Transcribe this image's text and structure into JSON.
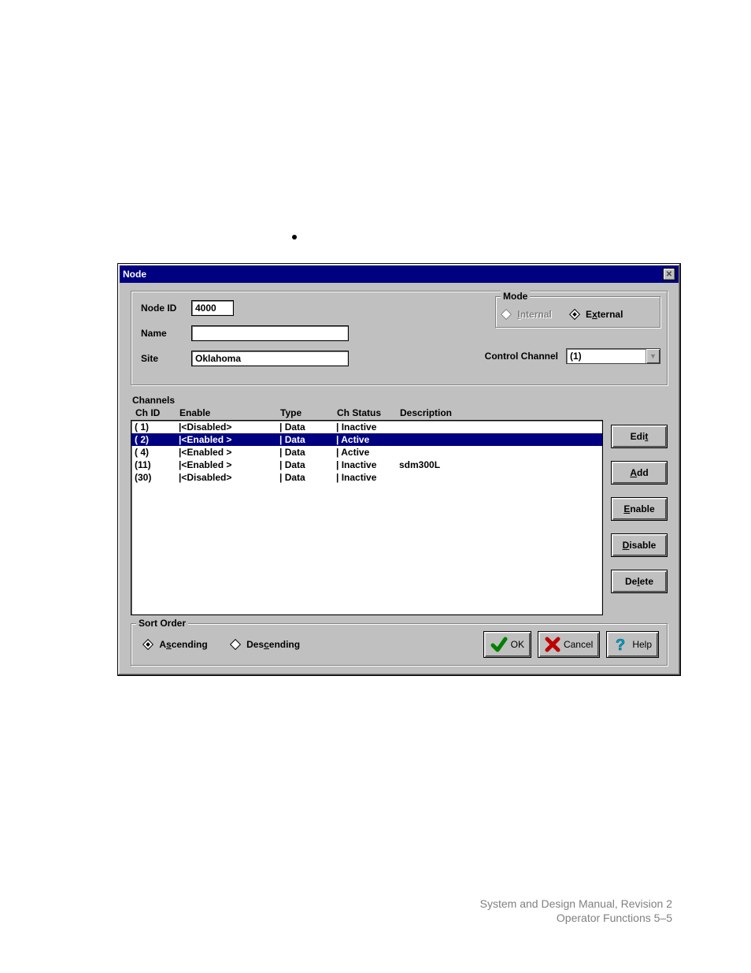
{
  "dialog": {
    "title": "Node",
    "fields": {
      "node_id_label": "Node ID",
      "node_id_value": "4000",
      "name_label": "Name",
      "name_value": "",
      "site_label": "Site",
      "site_value": "Oklahoma",
      "control_channel_label": "Control Channel",
      "control_channel_value": "(1)"
    },
    "mode": {
      "legend": "Mode",
      "internal_label": "Internal",
      "external_label": "External",
      "selected": "external"
    }
  },
  "channels": {
    "section_label": "Channels",
    "headers": {
      "id": "Ch ID",
      "enable": "Enable",
      "type": "Type",
      "status": "Ch Status",
      "desc": "Description"
    },
    "rows": [
      {
        "id": "( 1)",
        "enable": "|<Disabled>",
        "type": "| Data",
        "status": "| Inactive",
        "desc": "",
        "selected": false
      },
      {
        "id": "( 2)",
        "enable": "|<Enabled >",
        "type": "| Data",
        "status": "| Active",
        "desc": "",
        "selected": true
      },
      {
        "id": "( 4)",
        "enable": "|<Enabled >",
        "type": "| Data",
        "status": "| Active",
        "desc": "",
        "selected": false
      },
      {
        "id": "(11)",
        "enable": "|<Enabled >",
        "type": "| Data",
        "status": "| Inactive",
        "desc": "sdm300L",
        "selected": false
      },
      {
        "id": "(30)",
        "enable": "|<Disabled>",
        "type": "| Data",
        "status": "| Inactive",
        "desc": "",
        "selected": false
      }
    ]
  },
  "buttons": {
    "edit": "Edit",
    "add": "Add",
    "enable": "Enable",
    "disable": "Disable",
    "delete": "Delete",
    "ok": "OK",
    "cancel": "Cancel",
    "help": "Help"
  },
  "sort": {
    "legend": "Sort Order",
    "asc": "Ascending",
    "desc": "Descending",
    "selected": "asc"
  },
  "footer": {
    "line1": "System and Design Manual, Revision 2",
    "line2": "Operator Functions  5–5"
  }
}
